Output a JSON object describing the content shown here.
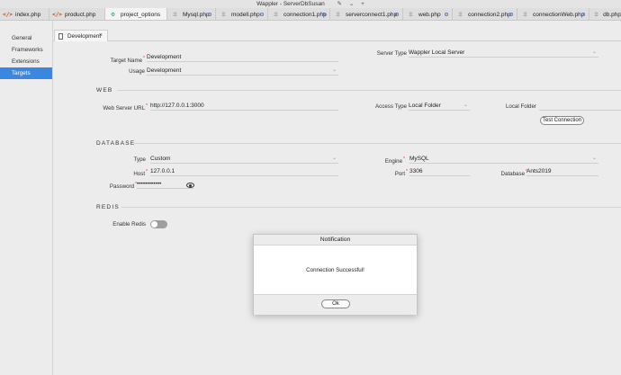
{
  "window": {
    "title": "Wappler - ServerDbSusan",
    "icons": [
      "pencil-icon",
      "chevron-down-icon",
      "plus-icon"
    ]
  },
  "file_tabs": [
    {
      "label": "index.php",
      "icon": "code-icon",
      "active": false
    },
    {
      "label": "product.php",
      "icon": "code-icon",
      "active": false
    },
    {
      "label": "project_options",
      "icon": "gear-icon",
      "active": true
    },
    {
      "label": "Mysql.php",
      "icon": "database-icon",
      "active": false
    },
    {
      "label": "modell.php",
      "icon": "database-icon",
      "active": false
    },
    {
      "label": "connection1.php",
      "icon": "database-icon",
      "active": false
    },
    {
      "label": "serverconnect1.php",
      "icon": "database-icon",
      "active": false
    },
    {
      "label": "web.php",
      "icon": "database-icon",
      "active": false
    },
    {
      "label": "connection2.php",
      "icon": "database-icon",
      "active": false
    },
    {
      "label": "connectionWeb.php",
      "icon": "database-icon",
      "active": false
    },
    {
      "label": "db.php",
      "icon": "database-icon",
      "active": false
    }
  ],
  "sidebar": {
    "items": [
      {
        "label": "General",
        "active": false
      },
      {
        "label": "Frameworks",
        "active": false
      },
      {
        "label": "Extensions",
        "active": false
      },
      {
        "label": "Targets",
        "active": true
      }
    ]
  },
  "target_tab": {
    "label": "Development",
    "close": "×"
  },
  "general": {
    "target_name_label": "Target Name",
    "target_name_value": "Development",
    "usage_label": "Usage",
    "usage_value": "Development",
    "server_type_label": "Server Type",
    "server_type_value": "Wappler Local Server"
  },
  "web": {
    "section": "WEB",
    "url_label": "Web Server URL",
    "url_value": "http://127.0.0.1:3000",
    "access_type_label": "Access Type",
    "access_type_value": "Local Folder",
    "local_folder_label": "Local Folder",
    "test_button": "Test Connection"
  },
  "database": {
    "section": "DATABASE",
    "type_label": "Type",
    "type_value": "Custom",
    "engine_label": "Engine",
    "engine_value": "MySQL",
    "host_label": "Host",
    "host_value": "127.0.0.1",
    "port_label": "Port",
    "port_value": "3306",
    "database_label": "Database",
    "database_value": "Ants2019",
    "password_label": "Password",
    "password_value": "••••••••••••"
  },
  "redis": {
    "section": "REDIS",
    "enable_label": "Enable Redis",
    "enabled": false
  },
  "dialog": {
    "title": "Notification",
    "message": "Connection Successful!",
    "ok_button": "Ok"
  },
  "colors": {
    "accent": "#3b87df",
    "required": "#dd3333",
    "code_icon": "#c8451c",
    "gear_icon": "#2a8f86"
  }
}
